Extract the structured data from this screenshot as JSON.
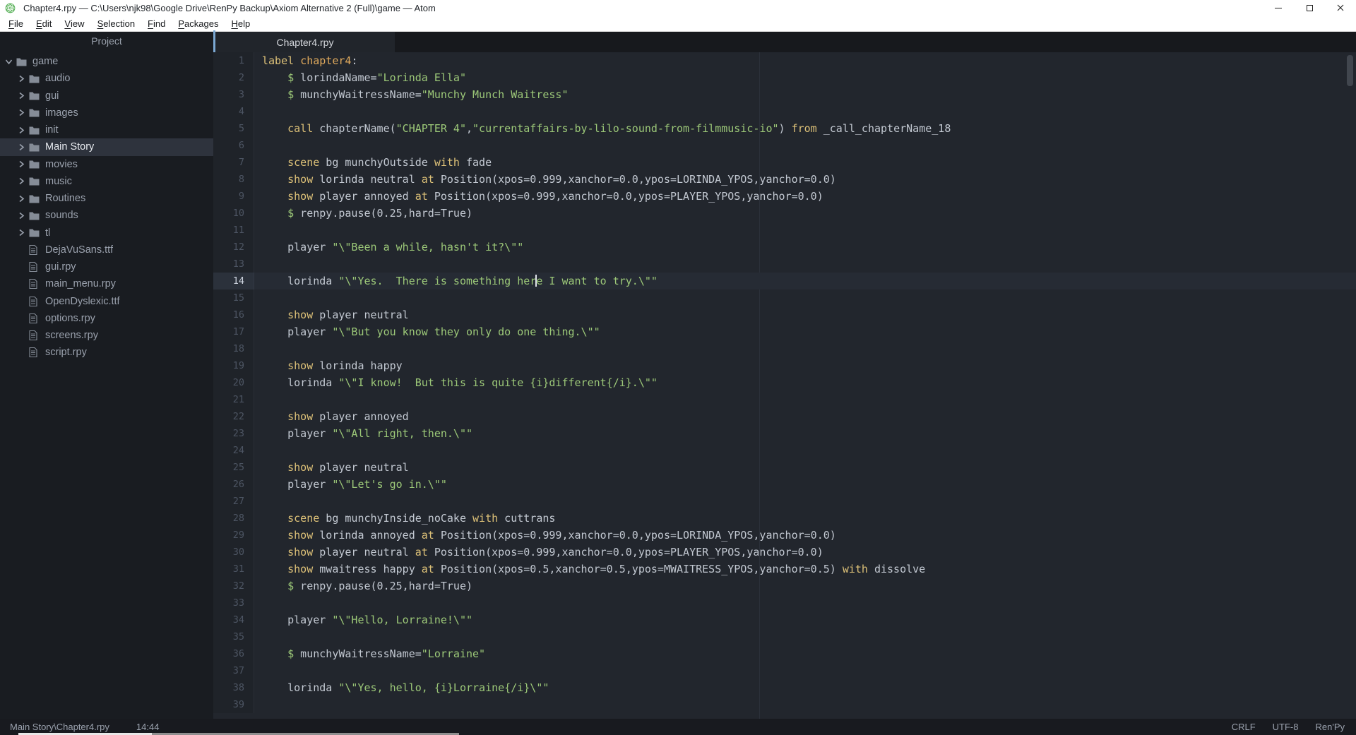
{
  "window": {
    "title": "Chapter4.rpy — C:\\Users\\njk98\\Google Drive\\RenPy Backup\\Axiom Alternative 2 (Full)\\game — Atom"
  },
  "menu": {
    "items": [
      {
        "label": "File",
        "accel_index": 0
      },
      {
        "label": "Edit",
        "accel_index": 0
      },
      {
        "label": "View",
        "accel_index": 0
      },
      {
        "label": "Selection",
        "accel_index": 0
      },
      {
        "label": "Find",
        "accel_index": 0
      },
      {
        "label": "Packages",
        "accel_index": 0
      },
      {
        "label": "Help",
        "accel_index": 0
      }
    ]
  },
  "tree": {
    "header": "Project",
    "items": [
      {
        "label": "game",
        "type": "folder",
        "depth": 0,
        "expanded": true,
        "selected": false
      },
      {
        "label": "audio",
        "type": "folder",
        "depth": 1,
        "expanded": false,
        "selected": false
      },
      {
        "label": "gui",
        "type": "folder",
        "depth": 1,
        "expanded": false,
        "selected": false
      },
      {
        "label": "images",
        "type": "folder",
        "depth": 1,
        "expanded": false,
        "selected": false
      },
      {
        "label": "init",
        "type": "folder",
        "depth": 1,
        "expanded": false,
        "selected": false
      },
      {
        "label": "Main Story",
        "type": "folder",
        "depth": 1,
        "expanded": false,
        "selected": true
      },
      {
        "label": "movies",
        "type": "folder",
        "depth": 1,
        "expanded": false,
        "selected": false
      },
      {
        "label": "music",
        "type": "folder",
        "depth": 1,
        "expanded": false,
        "selected": false
      },
      {
        "label": "Routines",
        "type": "folder",
        "depth": 1,
        "expanded": false,
        "selected": false
      },
      {
        "label": "sounds",
        "type": "folder",
        "depth": 1,
        "expanded": false,
        "selected": false
      },
      {
        "label": "tl",
        "type": "folder",
        "depth": 1,
        "expanded": false,
        "selected": false
      },
      {
        "label": "DejaVuSans.ttf",
        "type": "file",
        "depth": 1,
        "expanded": false,
        "selected": false
      },
      {
        "label": "gui.rpy",
        "type": "file",
        "depth": 1,
        "expanded": false,
        "selected": false
      },
      {
        "label": "main_menu.rpy",
        "type": "file",
        "depth": 1,
        "expanded": false,
        "selected": false
      },
      {
        "label": "OpenDyslexic.ttf",
        "type": "file",
        "depth": 1,
        "expanded": false,
        "selected": false
      },
      {
        "label": "options.rpy",
        "type": "file",
        "depth": 1,
        "expanded": false,
        "selected": false
      },
      {
        "label": "screens.rpy",
        "type": "file",
        "depth": 1,
        "expanded": false,
        "selected": false
      },
      {
        "label": "script.rpy",
        "type": "file",
        "depth": 1,
        "expanded": false,
        "selected": false
      }
    ]
  },
  "tab": {
    "label": "Chapter4.rpy"
  },
  "editor": {
    "cursor": {
      "line": 14,
      "column": 44
    },
    "lines": [
      {
        "n": 1,
        "seg": [
          [
            "label",
            "sk"
          ],
          [
            " ",
            "sd"
          ],
          [
            "chapter4",
            "sn"
          ],
          [
            ":",
            "sd"
          ]
        ]
      },
      {
        "n": 2,
        "seg": [
          [
            "    $",
            "ss"
          ],
          [
            " lorindaName=",
            "sd"
          ],
          [
            "\"Lorinda Ella\"",
            "ss"
          ]
        ]
      },
      {
        "n": 3,
        "seg": [
          [
            "    $",
            "ss"
          ],
          [
            " munchyWaitressName=",
            "sd"
          ],
          [
            "\"Munchy Munch Waitress\"",
            "ss"
          ]
        ]
      },
      {
        "n": 4,
        "seg": []
      },
      {
        "n": 5,
        "seg": [
          [
            "    ",
            "sd"
          ],
          [
            "call",
            "sk"
          ],
          [
            " chapterName(",
            "sd"
          ],
          [
            "\"CHAPTER 4\"",
            "ss"
          ],
          [
            ",",
            "sd"
          ],
          [
            "\"currentaffairs-by-lilo-sound-from-filmmusic-io\"",
            "ss"
          ],
          [
            ") ",
            "sd"
          ],
          [
            "from",
            "sk"
          ],
          [
            " _call_chapterName_18",
            "sd"
          ]
        ]
      },
      {
        "n": 6,
        "seg": []
      },
      {
        "n": 7,
        "seg": [
          [
            "    ",
            "sd"
          ],
          [
            "scene",
            "sk"
          ],
          [
            " bg munchyOutside ",
            "sd"
          ],
          [
            "with",
            "sk"
          ],
          [
            " fade",
            "sd"
          ]
        ]
      },
      {
        "n": 8,
        "seg": [
          [
            "    ",
            "sd"
          ],
          [
            "show",
            "sk"
          ],
          [
            " lorinda neutral ",
            "sd"
          ],
          [
            "at",
            "sk"
          ],
          [
            " Position(xpos=0.999,xanchor=0.0,ypos=LORINDA_YPOS,yanchor=0.0)",
            "sd"
          ]
        ]
      },
      {
        "n": 9,
        "seg": [
          [
            "    ",
            "sd"
          ],
          [
            "show",
            "sk"
          ],
          [
            " player annoyed ",
            "sd"
          ],
          [
            "at",
            "sk"
          ],
          [
            " Position(xpos=0.999,xanchor=0.0,ypos=PLAYER_YPOS,yanchor=0.0)",
            "sd"
          ]
        ]
      },
      {
        "n": 10,
        "seg": [
          [
            "    $",
            "ss"
          ],
          [
            " renpy.pause(0.25,hard=True)",
            "sd"
          ]
        ]
      },
      {
        "n": 11,
        "seg": []
      },
      {
        "n": 12,
        "seg": [
          [
            "    player ",
            "sd"
          ],
          [
            "\"\\\"Been a while, hasn't it?\\\"\"",
            "ss"
          ]
        ]
      },
      {
        "n": 13,
        "seg": []
      },
      {
        "n": 14,
        "seg": [
          [
            "    lorinda ",
            "sd"
          ],
          [
            "\"\\\"Yes.  There is something her",
            "ss"
          ],
          [
            "",
            "caret"
          ],
          [
            "e I want to try.\\\"\"",
            "ss"
          ]
        ]
      },
      {
        "n": 15,
        "seg": []
      },
      {
        "n": 16,
        "seg": [
          [
            "    ",
            "sd"
          ],
          [
            "show",
            "sk"
          ],
          [
            " player neutral",
            "sd"
          ]
        ]
      },
      {
        "n": 17,
        "seg": [
          [
            "    player ",
            "sd"
          ],
          [
            "\"\\\"But you know they only do one thing.\\\"\"",
            "ss"
          ]
        ]
      },
      {
        "n": 18,
        "seg": []
      },
      {
        "n": 19,
        "seg": [
          [
            "    ",
            "sd"
          ],
          [
            "show",
            "sk"
          ],
          [
            " lorinda happy",
            "sd"
          ]
        ]
      },
      {
        "n": 20,
        "seg": [
          [
            "    lorinda ",
            "sd"
          ],
          [
            "\"\\\"I know!  But this is quite {i}different{/i}.\\\"\"",
            "ss"
          ]
        ]
      },
      {
        "n": 21,
        "seg": []
      },
      {
        "n": 22,
        "seg": [
          [
            "    ",
            "sd"
          ],
          [
            "show",
            "sk"
          ],
          [
            " player annoyed",
            "sd"
          ]
        ]
      },
      {
        "n": 23,
        "seg": [
          [
            "    player ",
            "sd"
          ],
          [
            "\"\\\"All right, then.\\\"\"",
            "ss"
          ]
        ]
      },
      {
        "n": 24,
        "seg": []
      },
      {
        "n": 25,
        "seg": [
          [
            "    ",
            "sd"
          ],
          [
            "show",
            "sk"
          ],
          [
            " player neutral",
            "sd"
          ]
        ]
      },
      {
        "n": 26,
        "seg": [
          [
            "    player ",
            "sd"
          ],
          [
            "\"\\\"Let's go in.\\\"\"",
            "ss"
          ]
        ]
      },
      {
        "n": 27,
        "seg": []
      },
      {
        "n": 28,
        "seg": [
          [
            "    ",
            "sd"
          ],
          [
            "scene",
            "sk"
          ],
          [
            " bg munchyInside_noCake ",
            "sd"
          ],
          [
            "with",
            "sk"
          ],
          [
            " cuttrans",
            "sd"
          ]
        ]
      },
      {
        "n": 29,
        "seg": [
          [
            "    ",
            "sd"
          ],
          [
            "show",
            "sk"
          ],
          [
            " lorinda annoyed ",
            "sd"
          ],
          [
            "at",
            "sk"
          ],
          [
            " Position(xpos=0.999,xanchor=0.0,ypos=LORINDA_YPOS,yanchor=0.0)",
            "sd"
          ]
        ]
      },
      {
        "n": 30,
        "seg": [
          [
            "    ",
            "sd"
          ],
          [
            "show",
            "sk"
          ],
          [
            " player neutral ",
            "sd"
          ],
          [
            "at",
            "sk"
          ],
          [
            " Position(xpos=0.999,xanchor=0.0,ypos=PLAYER_YPOS,yanchor=0.0)",
            "sd"
          ]
        ]
      },
      {
        "n": 31,
        "seg": [
          [
            "    ",
            "sd"
          ],
          [
            "show",
            "sk"
          ],
          [
            " mwaitress happy ",
            "sd"
          ],
          [
            "at",
            "sk"
          ],
          [
            " Position(xpos=0.5,xanchor=0.5,ypos=MWAITRESS_YPOS,yanchor=0.5) ",
            "sd"
          ],
          [
            "with",
            "sk"
          ],
          [
            " dissolve",
            "sd"
          ]
        ]
      },
      {
        "n": 32,
        "seg": [
          [
            "    $",
            "ss"
          ],
          [
            " renpy.pause(0.25,hard=True)",
            "sd"
          ]
        ]
      },
      {
        "n": 33,
        "seg": []
      },
      {
        "n": 34,
        "seg": [
          [
            "    player ",
            "sd"
          ],
          [
            "\"\\\"Hello, Lorraine!\\\"\"",
            "ss"
          ]
        ]
      },
      {
        "n": 35,
        "seg": []
      },
      {
        "n": 36,
        "seg": [
          [
            "    $",
            "ss"
          ],
          [
            " munchyWaitressName=",
            "sd"
          ],
          [
            "\"Lorraine\"",
            "ss"
          ]
        ]
      },
      {
        "n": 37,
        "seg": []
      },
      {
        "n": 38,
        "seg": [
          [
            "    lorinda ",
            "sd"
          ],
          [
            "\"\\\"Yes, hello, {i}Lorraine{/i}\\\"\"",
            "ss"
          ]
        ]
      },
      {
        "n": 39,
        "seg": []
      }
    ]
  },
  "status": {
    "left": [
      {
        "id": "file-path",
        "label": "Main Story\\Chapter4.rpy"
      },
      {
        "id": "cursor-position",
        "label": "14:44"
      }
    ],
    "right": [
      {
        "id": "line-ending",
        "label": "CRLF"
      },
      {
        "id": "encoding",
        "label": "UTF-8"
      },
      {
        "id": "grammar",
        "label": "Ren'Py"
      }
    ]
  },
  "colors": {
    "accent_blue": "#7ca9d4",
    "keyword": "#ddc178",
    "label_name": "#e0aa5d",
    "string_green": "#9cc878",
    "editor_bg": "#22262d",
    "panel_bg": "#191c21",
    "titlebar_bg": "#ffffff"
  }
}
